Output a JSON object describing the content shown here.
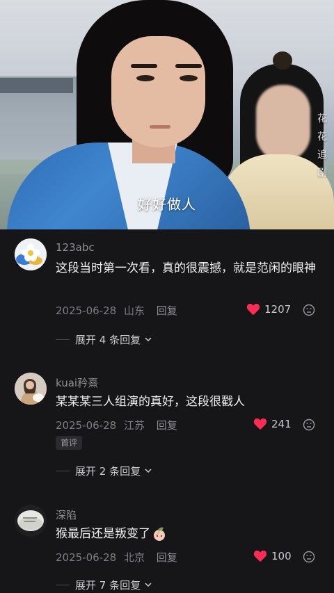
{
  "video": {
    "subtitle": "好好做人",
    "watermark": [
      "花",
      "花",
      "追",
      "剧"
    ]
  },
  "comments": [
    {
      "username": "123abc",
      "text": "这段当时第一次看，真的很震撼，就是范闲的眼神",
      "date": "2025-06-28",
      "location": "山东",
      "reply_label": "回复",
      "likes": "1207",
      "badge": "",
      "expand_label": "展开 4 条回复",
      "avatar_icon": "flower-avatar-icon"
    },
    {
      "username": "kuai矜熹",
      "text": "某某某三人组演的真好，这段很戳人",
      "date": "2025-06-28",
      "location": "江苏",
      "reply_label": "回复",
      "likes": "241",
      "badge": "首评",
      "expand_label": "展开 2 条回复",
      "avatar_icon": "person-with-dog-avatar"
    },
    {
      "username": "深陷",
      "text": "猴最后还是叛变了",
      "emoji": "peach-emoji",
      "date": "2025-06-28",
      "location": "北京",
      "reply_label": "回复",
      "likes": "100",
      "badge": "",
      "expand_label": "展开 7 条回复",
      "avatar_icon": "round-stone-avatar"
    }
  ],
  "colors": {
    "background": "#161618",
    "like_heart": "#fe2c55",
    "username": "#8e8e93"
  }
}
